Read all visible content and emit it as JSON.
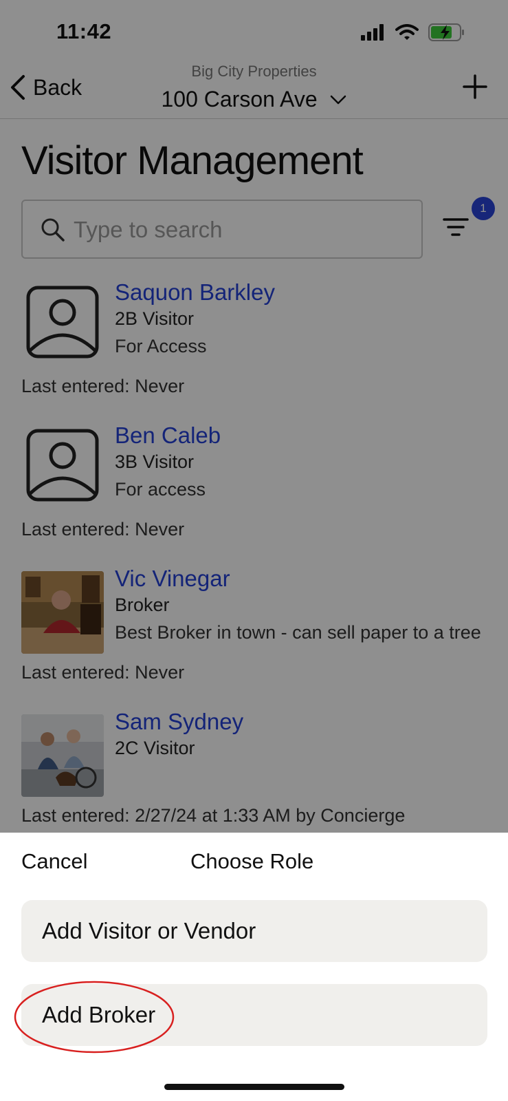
{
  "status_bar": {
    "time": "11:42"
  },
  "nav": {
    "back_label": "Back",
    "subtitle": "Big City Properties",
    "title": "100 Carson Ave"
  },
  "page": {
    "title": "Visitor Management"
  },
  "search": {
    "placeholder": "Type to search"
  },
  "filter": {
    "badge_count": "1"
  },
  "visitors": [
    {
      "name": "Saquon Barkley",
      "role": "2B Visitor",
      "description": "For Access",
      "last_entered": "Last entered: Never"
    },
    {
      "name": "Ben Caleb",
      "role": "3B Visitor",
      "description": "For access",
      "last_entered": "Last entered: Never"
    },
    {
      "name": "Vic Vinegar",
      "role": "Broker",
      "description": "Best Broker in town - can sell paper to a tree",
      "last_entered": "Last entered: Never"
    },
    {
      "name": "Sam Sydney",
      "role": "2C Visitor",
      "description": "",
      "last_entered": "Last entered: 2/27/24 at 1:33 AM by Concierge"
    }
  ],
  "sheet": {
    "cancel_label": "Cancel",
    "title": "Choose Role",
    "options": [
      "Add Visitor or Vendor",
      "Add Broker"
    ]
  },
  "colors": {
    "link_blue": "#2441d6",
    "badge_blue": "#2a45d8",
    "highlight_red": "#d8201f",
    "option_bg": "#f0efec"
  }
}
